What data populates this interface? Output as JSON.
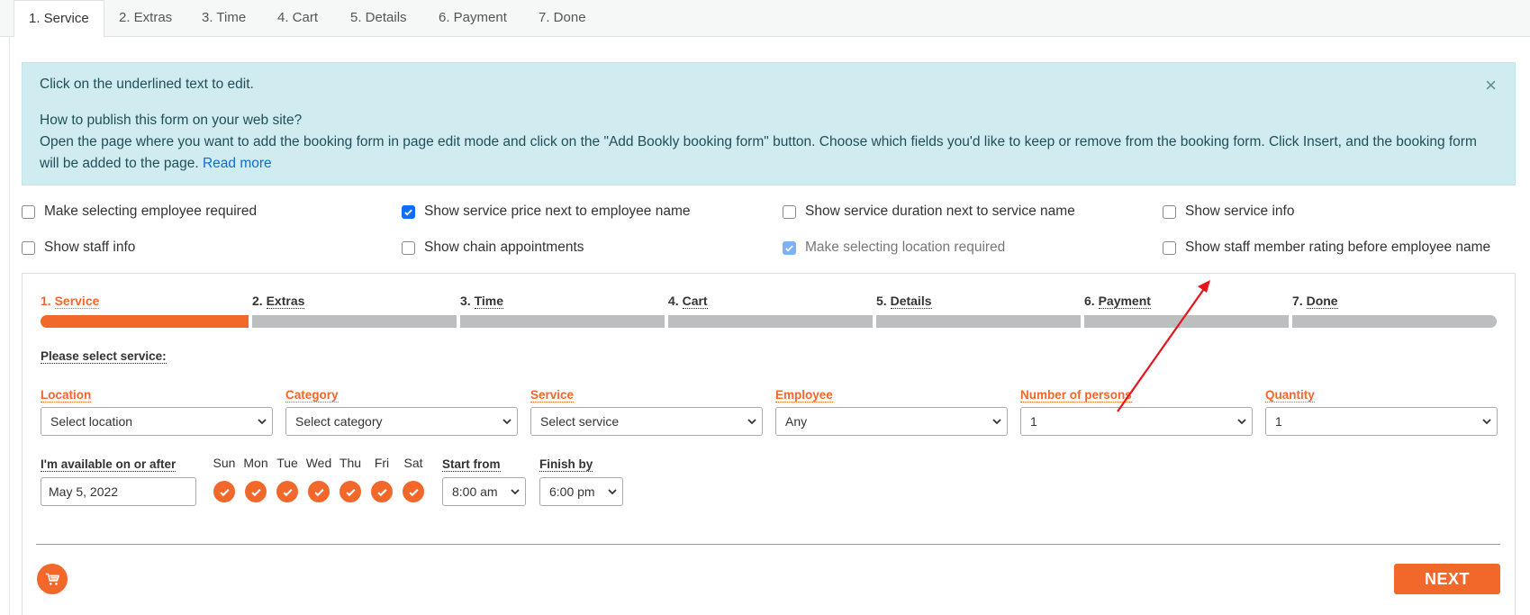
{
  "tabs": [
    {
      "label": "1. Service"
    },
    {
      "label": "2. Extras"
    },
    {
      "label": "3. Time"
    },
    {
      "label": "4. Cart"
    },
    {
      "label": "5. Details"
    },
    {
      "label": "6. Payment"
    },
    {
      "label": "7. Done"
    }
  ],
  "alert": {
    "line1": "Click on the underlined text to edit.",
    "question": "How to publish this form on your web site?",
    "body": "Open the page where you want to add the booking form in page edit mode and click on the \"Add Bookly booking form\" button. Choose which fields you'd like to keep or remove from the booking form. Click Insert, and the booking form will be added to the page.",
    "read_more": "Read more",
    "close": "×"
  },
  "options": [
    {
      "label": "Make selecting employee required",
      "checked": false
    },
    {
      "label": "Show service price next to employee name",
      "checked": true
    },
    {
      "label": "Show service duration next to service name",
      "checked": false
    },
    {
      "label": "Show service info",
      "checked": false
    },
    {
      "label": "Show staff info",
      "checked": false
    },
    {
      "label": "Show chain appointments",
      "checked": false
    },
    {
      "label": "Make selecting location required",
      "checked": true,
      "disabled": true
    },
    {
      "label": "Show staff member rating before employee name",
      "checked": false
    }
  ],
  "steps": [
    {
      "num": "1.",
      "label": "Service"
    },
    {
      "num": "2.",
      "label": "Extras"
    },
    {
      "num": "3.",
      "label": "Time"
    },
    {
      "num": "4.",
      "label": "Cart"
    },
    {
      "num": "5.",
      "label": "Details"
    },
    {
      "num": "6.",
      "label": "Payment"
    },
    {
      "num": "7.",
      "label": "Done"
    }
  ],
  "form": {
    "section_title": "Please select service:",
    "fields": [
      {
        "label": "Location",
        "value": "Select location"
      },
      {
        "label": "Category",
        "value": "Select category"
      },
      {
        "label": "Service",
        "value": "Select service"
      },
      {
        "label": "Employee",
        "value": "Any"
      },
      {
        "label": "Number of persons",
        "value": "1"
      },
      {
        "label": "Quantity",
        "value": "1"
      }
    ],
    "available_label": "I'm available on or after",
    "date_value": "May 5, 2022",
    "days": [
      "Sun",
      "Mon",
      "Tue",
      "Wed",
      "Thu",
      "Fri",
      "Sat"
    ],
    "start_label": "Start from",
    "start_value": "8:00 am",
    "finish_label": "Finish by",
    "finish_value": "6:00 pm",
    "next_label": "NEXT"
  },
  "colors": {
    "accent": "#f2672a",
    "alert_bg": "#d1ecf1",
    "checkbox": "#0d6efd"
  }
}
